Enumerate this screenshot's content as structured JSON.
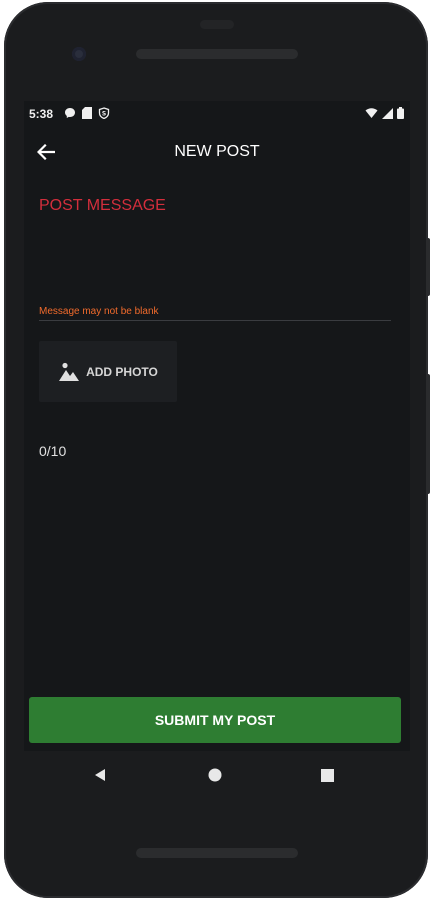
{
  "status_bar": {
    "time": "5:38",
    "left_icons": [
      "messenger-icon",
      "sd-card-icon",
      "shield-icon"
    ],
    "right_icons": [
      "wifi-icon",
      "signal-icon",
      "battery-icon"
    ]
  },
  "toolbar": {
    "title": "NEW POST",
    "back_icon": "arrow-left-icon"
  },
  "form": {
    "message_label": "POST MESSAGE",
    "message_value": "",
    "error_text": "Message may not be blank",
    "add_photo_label": "ADD PHOTO",
    "add_photo_icon": "image-icon",
    "counter": "0/10",
    "submit_label": "SUBMIT MY POST"
  },
  "nav_bar": {
    "back_icon": "triangle-back-icon",
    "home_icon": "circle-home-icon",
    "recents_icon": "square-recents-icon"
  },
  "colors": {
    "background": "#151719",
    "label_error": "#d32e3c",
    "error_text": "#f26b2c",
    "submit": "#2e7d32"
  }
}
